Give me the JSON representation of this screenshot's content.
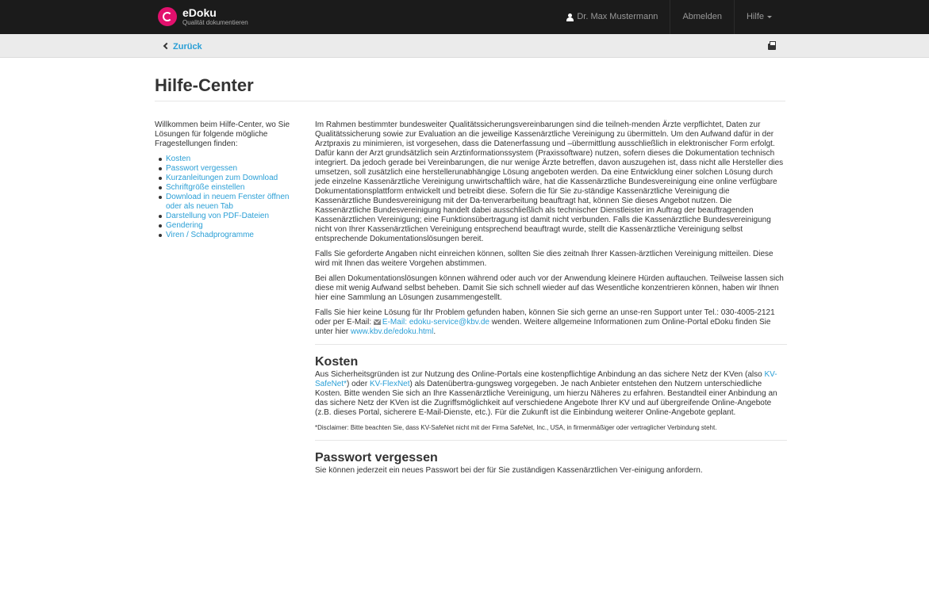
{
  "topbar": {
    "app_name": "eDoku",
    "app_tagline": "Qualität dokumentieren",
    "user_name": "Dr. Max Mustermann",
    "logout": "Abmelden",
    "help": "Hilfe"
  },
  "subbar": {
    "back": "Zurück"
  },
  "page": {
    "title": "Hilfe-Center"
  },
  "sidebar": {
    "intro": "Willkommen beim Hilfe-Center, wo Sie Lösungen für folgende mögliche Fragestellungen finden:",
    "items": [
      "Kosten",
      "Passwort vergessen",
      "Kurzanleitungen zum Download",
      "Schriftgröße einstellen",
      "Download in neuem Fenster öffnen oder als neuen Tab",
      "Darstellung von PDF-Dateien",
      "Gendering",
      "Viren / Schadprogramme"
    ]
  },
  "main": {
    "intro_p1": "Im Rahmen bestimmter bundesweiter Qualitätssicherungsvereinbarungen sind die teilneh-menden Ärzte verpflichtet, Daten zur Qualitätssicherung sowie zur Evaluation an die jeweilige Kassenärztliche Vereinigung zu übermitteln. Um den Aufwand dafür in der Arztpraxis zu minimieren, ist vorgesehen, dass die Datenerfassung und –übermittlung ausschließlich in elektronischer Form erfolgt. Dafür kann der Arzt grundsätzlich sein Arztinformationssystem (Praxissoftware) nutzen, sofern dieses die Dokumentation technisch integriert. Da jedoch gerade bei Vereinbarungen, die nur wenige Ärzte betreffen, davon auszugehen ist, dass nicht alle Hersteller dies umsetzen, soll zusätzlich eine herstellerunabhängige Lösung angeboten werden. Da eine Entwicklung einer solchen Lösung durch jede einzelne Kassenärztliche Vereinigung unwirtschaftlich wäre, hat die Kassenärztliche Bundesvereinigung eine online verfügbare Dokumentationsplattform entwickelt und betreibt diese. Sofern die für Sie zu-ständige Kassenärztliche Vereinigung die Kassenärztliche Bundesvereinigung mit der Da-tenverarbeitung beauftragt hat, können Sie dieses Angebot nutzen. Die Kassenärztliche Bundesvereinigung handelt dabei ausschließlich als technischer Dienstleister im Auftrag der beauftragenden Kassenärztlichen Vereinigung; eine Funktionsübertragung ist damit nicht verbunden. Falls die Kassenärztliche Bundesvereinigung nicht von Ihrer Kassenärztlichen Vereinigung entsprechend beauftragt wurde, stellt die Kassenärztliche Vereinigung selbst entsprechende Dokumentationslösungen bereit.",
    "intro_p2": "Falls Sie geforderte Angaben nicht einreichen können, sollten Sie dies zeitnah Ihrer Kassen-ärztlichen Vereinigung mitteilen. Diese wird mit Ihnen das weitere Vorgehen abstimmen.",
    "intro_p3": "Bei allen Dokumentationslösungen können während oder auch vor der Anwendung kleinere Hürden auftauchen. Teilweise lassen sich diese mit wenig Aufwand selbst beheben. Damit Sie sich schnell wieder auf das Wesentliche konzentrieren können, haben wir Ihnen hier eine Sammlung an Lösungen zusammengestellt.",
    "support_pre": "Falls Sie hier keine Lösung für Ihr Problem gefunden haben, können Sie sich gerne an unse-ren Support unter Tel.: 030-4005-2121 oder per E-Mail: ",
    "support_email": "E-Mail: edoku-service@kbv.de",
    "support_mid": " wenden. Weitere allgemeine Informationen zum Online-Portal eDoku finden Sie unter hier ",
    "support_link": "www.kbv.de/edoku.html",
    "support_post": ".",
    "kosten_title": "Kosten",
    "kosten_pre": "Aus Sicherheitsgründen ist zur Nutzung des Online-Portals eine kostenpflichtige Anbindung an das sichere Netz der KVen (also ",
    "kosten_link1": "KV-SafeNet*",
    "kosten_mid": ") oder ",
    "kosten_link2": "KV-FlexNet",
    "kosten_post": ") als Datenübertra-gungsweg vorgegeben. Je nach Anbieter entstehen den Nutzern unterschiedliche Kosten. Bitte wenden Sie sich an Ihre Kassenärztliche Vereinigung, um hierzu Näheres zu erfahren. Bestandteil einer Anbindung an das sichere Netz der KVen ist die Zugriffsmöglichkeit auf verschiedene Angebote Ihrer KV und auf übergreifende Online-Angebote (z.B. dieses Portal, sicherere E-Mail-Dienste, etc.). Für die Zukunft ist die Einbindung weiterer Online-Angebote geplant.",
    "disclaimer": "*Disclaimer: Bitte beachten Sie, dass KV-SafeNet nicht mit der Firma SafeNet, Inc., USA, in firmenmäßiger oder vertraglicher Verbindung steht.",
    "passwort_title": "Passwort vergessen",
    "passwort_text": "Sie können jederzeit ein neues Passwort bei der für Sie zuständigen Kassenärztlichen Ver-einigung anfordern."
  }
}
